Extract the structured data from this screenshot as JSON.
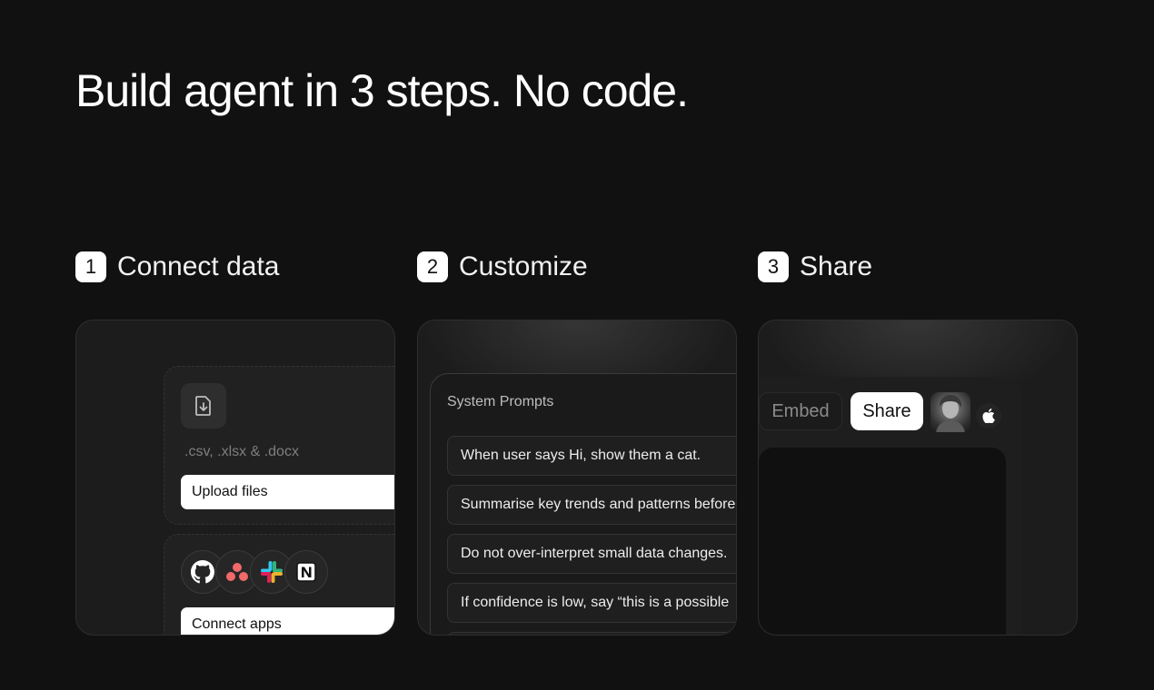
{
  "headline": "Build agent in 3 steps. No code.",
  "steps": [
    {
      "number": "1",
      "title": "Connect data"
    },
    {
      "number": "2",
      "title": "Customize"
    },
    {
      "number": "3",
      "title": "Share"
    }
  ],
  "connect": {
    "file_types": ".csv, .xlsx & .docx",
    "upload_label": "Upload files",
    "apps": [
      "github-icon",
      "asana-icon",
      "slack-icon",
      "notion-icon"
    ],
    "connect_label": "Connect apps"
  },
  "customize": {
    "panel_title": "System Prompts",
    "prompts": [
      "When user says Hi, show them a cat.",
      "Summarise key trends and patterns before",
      "Do not over-interpret small data changes.",
      "If confidence is low, say “this is a possible"
    ]
  },
  "share": {
    "embed_label": "Embed",
    "share_label": "Share"
  },
  "colors": {
    "background": "#111111",
    "card": "#1c1c1c",
    "asana": "#f06a6a",
    "slack_blue": "#36c5f0",
    "slack_green": "#2eb67d",
    "slack_yellow": "#ecb22e",
    "slack_red": "#e01e5a"
  }
}
